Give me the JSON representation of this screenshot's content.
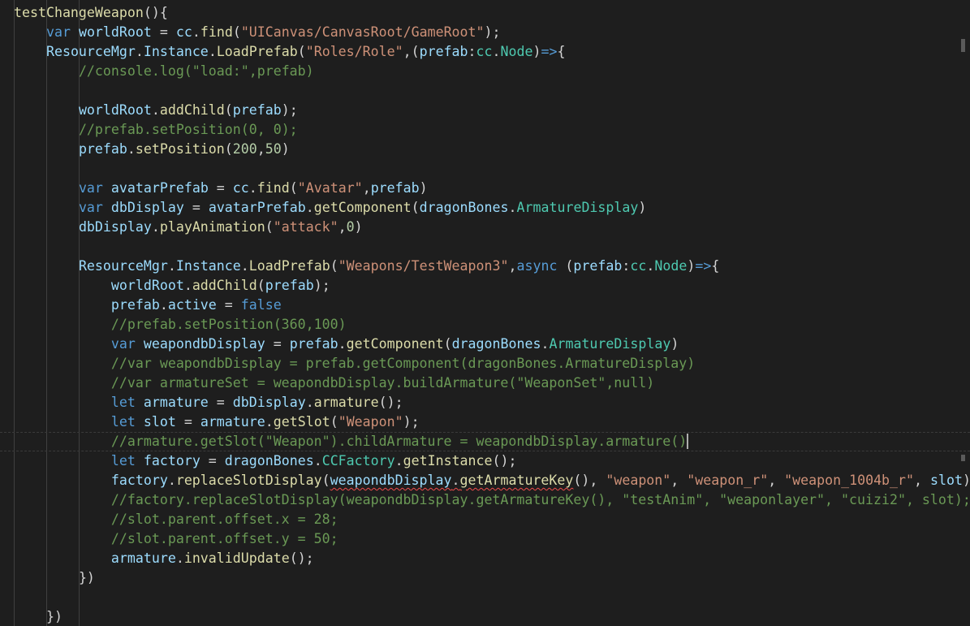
{
  "colors": {
    "background": "#1e1e1e",
    "text": "#d4d4d4",
    "keyword": "#569cd6",
    "function": "#dcdcaa",
    "variable": "#9cdcfe",
    "type": "#4ec9b0",
    "string": "#ce9178",
    "number": "#b5cea8",
    "comment": "#6a9955"
  },
  "code": {
    "lines": [
      [
        {
          "t": "testChangeWeapon",
          "c": "function"
        },
        {
          "t": "(){",
          "c": "text"
        }
      ],
      [
        {
          "t": "    ",
          "c": "text"
        },
        {
          "t": "var",
          "c": "keyword"
        },
        {
          "t": " ",
          "c": "text"
        },
        {
          "t": "worldRoot",
          "c": "variable"
        },
        {
          "t": " = ",
          "c": "text"
        },
        {
          "t": "cc",
          "c": "variable"
        },
        {
          "t": ".",
          "c": "text"
        },
        {
          "t": "find",
          "c": "function"
        },
        {
          "t": "(",
          "c": "text"
        },
        {
          "t": "\"UICanvas/CanvasRoot/GameRoot\"",
          "c": "string"
        },
        {
          "t": ");",
          "c": "text"
        }
      ],
      [
        {
          "t": "    ",
          "c": "text"
        },
        {
          "t": "ResourceMgr",
          "c": "variable"
        },
        {
          "t": ".",
          "c": "text"
        },
        {
          "t": "Instance",
          "c": "variable"
        },
        {
          "t": ".",
          "c": "text"
        },
        {
          "t": "LoadPrefab",
          "c": "function"
        },
        {
          "t": "(",
          "c": "text"
        },
        {
          "t": "\"Roles/Role\"",
          "c": "string"
        },
        {
          "t": ",(",
          "c": "text"
        },
        {
          "t": "prefab",
          "c": "variable"
        },
        {
          "t": ":",
          "c": "text"
        },
        {
          "t": "cc",
          "c": "type"
        },
        {
          "t": ".",
          "c": "text"
        },
        {
          "t": "Node",
          "c": "type"
        },
        {
          "t": ")",
          "c": "text"
        },
        {
          "t": "=>",
          "c": "keyword"
        },
        {
          "t": "{",
          "c": "text"
        }
      ],
      [
        {
          "t": "        ",
          "c": "text"
        },
        {
          "t": "//console.log(\"load:\",prefab)",
          "c": "comment"
        }
      ],
      [
        {
          "t": "",
          "c": "text"
        }
      ],
      [
        {
          "t": "        ",
          "c": "text"
        },
        {
          "t": "worldRoot",
          "c": "variable"
        },
        {
          "t": ".",
          "c": "text"
        },
        {
          "t": "addChild",
          "c": "function"
        },
        {
          "t": "(",
          "c": "text"
        },
        {
          "t": "prefab",
          "c": "variable"
        },
        {
          "t": ");",
          "c": "text"
        }
      ],
      [
        {
          "t": "        ",
          "c": "text"
        },
        {
          "t": "//prefab.setPosition(0, 0);",
          "c": "comment"
        }
      ],
      [
        {
          "t": "        ",
          "c": "text"
        },
        {
          "t": "prefab",
          "c": "variable"
        },
        {
          "t": ".",
          "c": "text"
        },
        {
          "t": "setPosition",
          "c": "function"
        },
        {
          "t": "(",
          "c": "text"
        },
        {
          "t": "200",
          "c": "number"
        },
        {
          "t": ",",
          "c": "text"
        },
        {
          "t": "50",
          "c": "number"
        },
        {
          "t": ")",
          "c": "text"
        }
      ],
      [
        {
          "t": "",
          "c": "text"
        }
      ],
      [
        {
          "t": "        ",
          "c": "text"
        },
        {
          "t": "var",
          "c": "keyword"
        },
        {
          "t": " ",
          "c": "text"
        },
        {
          "t": "avatarPrefab",
          "c": "variable"
        },
        {
          "t": " = ",
          "c": "text"
        },
        {
          "t": "cc",
          "c": "variable"
        },
        {
          "t": ".",
          "c": "text"
        },
        {
          "t": "find",
          "c": "function"
        },
        {
          "t": "(",
          "c": "text"
        },
        {
          "t": "\"Avatar\"",
          "c": "string"
        },
        {
          "t": ",",
          "c": "text"
        },
        {
          "t": "prefab",
          "c": "variable"
        },
        {
          "t": ")",
          "c": "text"
        }
      ],
      [
        {
          "t": "        ",
          "c": "text"
        },
        {
          "t": "var",
          "c": "keyword"
        },
        {
          "t": " ",
          "c": "text"
        },
        {
          "t": "dbDisplay",
          "c": "variable"
        },
        {
          "t": " = ",
          "c": "text"
        },
        {
          "t": "avatarPrefab",
          "c": "variable"
        },
        {
          "t": ".",
          "c": "text"
        },
        {
          "t": "getComponent",
          "c": "function"
        },
        {
          "t": "(",
          "c": "text"
        },
        {
          "t": "dragonBones",
          "c": "variable"
        },
        {
          "t": ".",
          "c": "text"
        },
        {
          "t": "ArmatureDisplay",
          "c": "type"
        },
        {
          "t": ")",
          "c": "text"
        }
      ],
      [
        {
          "t": "        ",
          "c": "text"
        },
        {
          "t": "dbDisplay",
          "c": "variable"
        },
        {
          "t": ".",
          "c": "text"
        },
        {
          "t": "playAnimation",
          "c": "function"
        },
        {
          "t": "(",
          "c": "text"
        },
        {
          "t": "\"attack\"",
          "c": "string"
        },
        {
          "t": ",",
          "c": "text"
        },
        {
          "t": "0",
          "c": "number"
        },
        {
          "t": ")",
          "c": "text"
        }
      ],
      [
        {
          "t": "",
          "c": "text"
        }
      ],
      [
        {
          "t": "        ",
          "c": "text"
        },
        {
          "t": "ResourceMgr",
          "c": "variable"
        },
        {
          "t": ".",
          "c": "text"
        },
        {
          "t": "Instance",
          "c": "variable"
        },
        {
          "t": ".",
          "c": "text"
        },
        {
          "t": "LoadPrefab",
          "c": "function"
        },
        {
          "t": "(",
          "c": "text"
        },
        {
          "t": "\"Weapons/TestWeapon3\"",
          "c": "string"
        },
        {
          "t": ",",
          "c": "text"
        },
        {
          "t": "async",
          "c": "keyword"
        },
        {
          "t": " (",
          "c": "text"
        },
        {
          "t": "prefab",
          "c": "variable"
        },
        {
          "t": ":",
          "c": "text"
        },
        {
          "t": "cc",
          "c": "type"
        },
        {
          "t": ".",
          "c": "text"
        },
        {
          "t": "Node",
          "c": "type"
        },
        {
          "t": ")",
          "c": "text"
        },
        {
          "t": "=>",
          "c": "keyword"
        },
        {
          "t": "{",
          "c": "text"
        }
      ],
      [
        {
          "t": "            ",
          "c": "text"
        },
        {
          "t": "worldRoot",
          "c": "variable"
        },
        {
          "t": ".",
          "c": "text"
        },
        {
          "t": "addChild",
          "c": "function"
        },
        {
          "t": "(",
          "c": "text"
        },
        {
          "t": "prefab",
          "c": "variable"
        },
        {
          "t": ");",
          "c": "text"
        }
      ],
      [
        {
          "t": "            ",
          "c": "text"
        },
        {
          "t": "prefab",
          "c": "variable"
        },
        {
          "t": ".",
          "c": "text"
        },
        {
          "t": "active",
          "c": "variable"
        },
        {
          "t": " = ",
          "c": "text"
        },
        {
          "t": "false",
          "c": "keyword"
        }
      ],
      [
        {
          "t": "            ",
          "c": "text"
        },
        {
          "t": "//prefab.setPosition(360,100)",
          "c": "comment"
        }
      ],
      [
        {
          "t": "            ",
          "c": "text"
        },
        {
          "t": "var",
          "c": "keyword"
        },
        {
          "t": " ",
          "c": "text"
        },
        {
          "t": "weapondbDisplay",
          "c": "variable"
        },
        {
          "t": " = ",
          "c": "text"
        },
        {
          "t": "prefab",
          "c": "variable"
        },
        {
          "t": ".",
          "c": "text"
        },
        {
          "t": "getComponent",
          "c": "function"
        },
        {
          "t": "(",
          "c": "text"
        },
        {
          "t": "dragonBones",
          "c": "variable"
        },
        {
          "t": ".",
          "c": "text"
        },
        {
          "t": "ArmatureDisplay",
          "c": "type"
        },
        {
          "t": ")",
          "c": "text"
        }
      ],
      [
        {
          "t": "            ",
          "c": "text"
        },
        {
          "t": "//var weapondbDisplay = prefab.getComponent(dragonBones.ArmatureDisplay)",
          "c": "comment"
        }
      ],
      [
        {
          "t": "            ",
          "c": "text"
        },
        {
          "t": "//var armatureSet = weapondbDisplay.buildArmature(\"WeaponSet\",null)",
          "c": "comment"
        }
      ],
      [
        {
          "t": "            ",
          "c": "text"
        },
        {
          "t": "let",
          "c": "keyword"
        },
        {
          "t": " ",
          "c": "text"
        },
        {
          "t": "armature",
          "c": "variable"
        },
        {
          "t": " = ",
          "c": "text"
        },
        {
          "t": "dbDisplay",
          "c": "variable"
        },
        {
          "t": ".",
          "c": "text"
        },
        {
          "t": "armature",
          "c": "function"
        },
        {
          "t": "();",
          "c": "text"
        }
      ],
      [
        {
          "t": "            ",
          "c": "text"
        },
        {
          "t": "let",
          "c": "keyword"
        },
        {
          "t": " ",
          "c": "text"
        },
        {
          "t": "slot",
          "c": "variable"
        },
        {
          "t": " = ",
          "c": "text"
        },
        {
          "t": "armature",
          "c": "variable"
        },
        {
          "t": ".",
          "c": "text"
        },
        {
          "t": "getSlot",
          "c": "function"
        },
        {
          "t": "(",
          "c": "text"
        },
        {
          "t": "\"Weapon\"",
          "c": "string"
        },
        {
          "t": ");",
          "c": "text"
        }
      ],
      [
        {
          "t": "            ",
          "c": "text"
        },
        {
          "t": "//armature.getSlot(\"Weapon\").childArmature = weapondbDisplay.armature()",
          "c": "comment"
        },
        {
          "t": "",
          "c": "cursor"
        }
      ],
      [
        {
          "t": "            ",
          "c": "text"
        },
        {
          "t": "let",
          "c": "keyword"
        },
        {
          "t": " ",
          "c": "text"
        },
        {
          "t": "factory",
          "c": "variable"
        },
        {
          "t": " = ",
          "c": "text"
        },
        {
          "t": "dragonBones",
          "c": "variable"
        },
        {
          "t": ".",
          "c": "text"
        },
        {
          "t": "CCFactory",
          "c": "type"
        },
        {
          "t": ".",
          "c": "text"
        },
        {
          "t": "getInstance",
          "c": "function"
        },
        {
          "t": "();",
          "c": "text"
        }
      ],
      [
        {
          "t": "            ",
          "c": "text"
        },
        {
          "t": "factory",
          "c": "variable"
        },
        {
          "t": ".",
          "c": "text"
        },
        {
          "t": "replaceSlotDisplay",
          "c": "function"
        },
        {
          "t": "(",
          "c": "text"
        },
        {
          "t": "weapondbDisplay",
          "c": "variable",
          "e": 1
        },
        {
          "t": ".",
          "c": "text",
          "e": 1
        },
        {
          "t": "getArmatureKey",
          "c": "function",
          "e": 1
        },
        {
          "t": "(), ",
          "c": "text"
        },
        {
          "t": "\"weapon\"",
          "c": "string"
        },
        {
          "t": ", ",
          "c": "text"
        },
        {
          "t": "\"weapon_r\"",
          "c": "string"
        },
        {
          "t": ", ",
          "c": "text"
        },
        {
          "t": "\"weapon_1004b_r\"",
          "c": "string"
        },
        {
          "t": ", ",
          "c": "text"
        },
        {
          "t": "slot",
          "c": "variable"
        },
        {
          "t": ");",
          "c": "text"
        }
      ],
      [
        {
          "t": "            ",
          "c": "text"
        },
        {
          "t": "//factory.replaceSlotDisplay(weapondbDisplay.getArmatureKey(), \"testAnim\", \"weaponlayer\", \"cuizi2\", slot);",
          "c": "comment"
        }
      ],
      [
        {
          "t": "            ",
          "c": "text"
        },
        {
          "t": "//slot.parent.offset.x = 28;",
          "c": "comment"
        }
      ],
      [
        {
          "t": "            ",
          "c": "text"
        },
        {
          "t": "//slot.parent.offset.y = 50;",
          "c": "comment"
        }
      ],
      [
        {
          "t": "            ",
          "c": "text"
        },
        {
          "t": "armature",
          "c": "variable"
        },
        {
          "t": ".",
          "c": "text"
        },
        {
          "t": "invalidUpdate",
          "c": "function"
        },
        {
          "t": "();",
          "c": "text"
        }
      ],
      [
        {
          "t": "        ",
          "c": "text"
        },
        {
          "t": "})",
          "c": "text"
        }
      ],
      [
        {
          "t": "",
          "c": "text"
        }
      ],
      [
        {
          "t": "    ",
          "c": "text"
        },
        {
          "t": "})",
          "c": "text"
        }
      ]
    ]
  }
}
